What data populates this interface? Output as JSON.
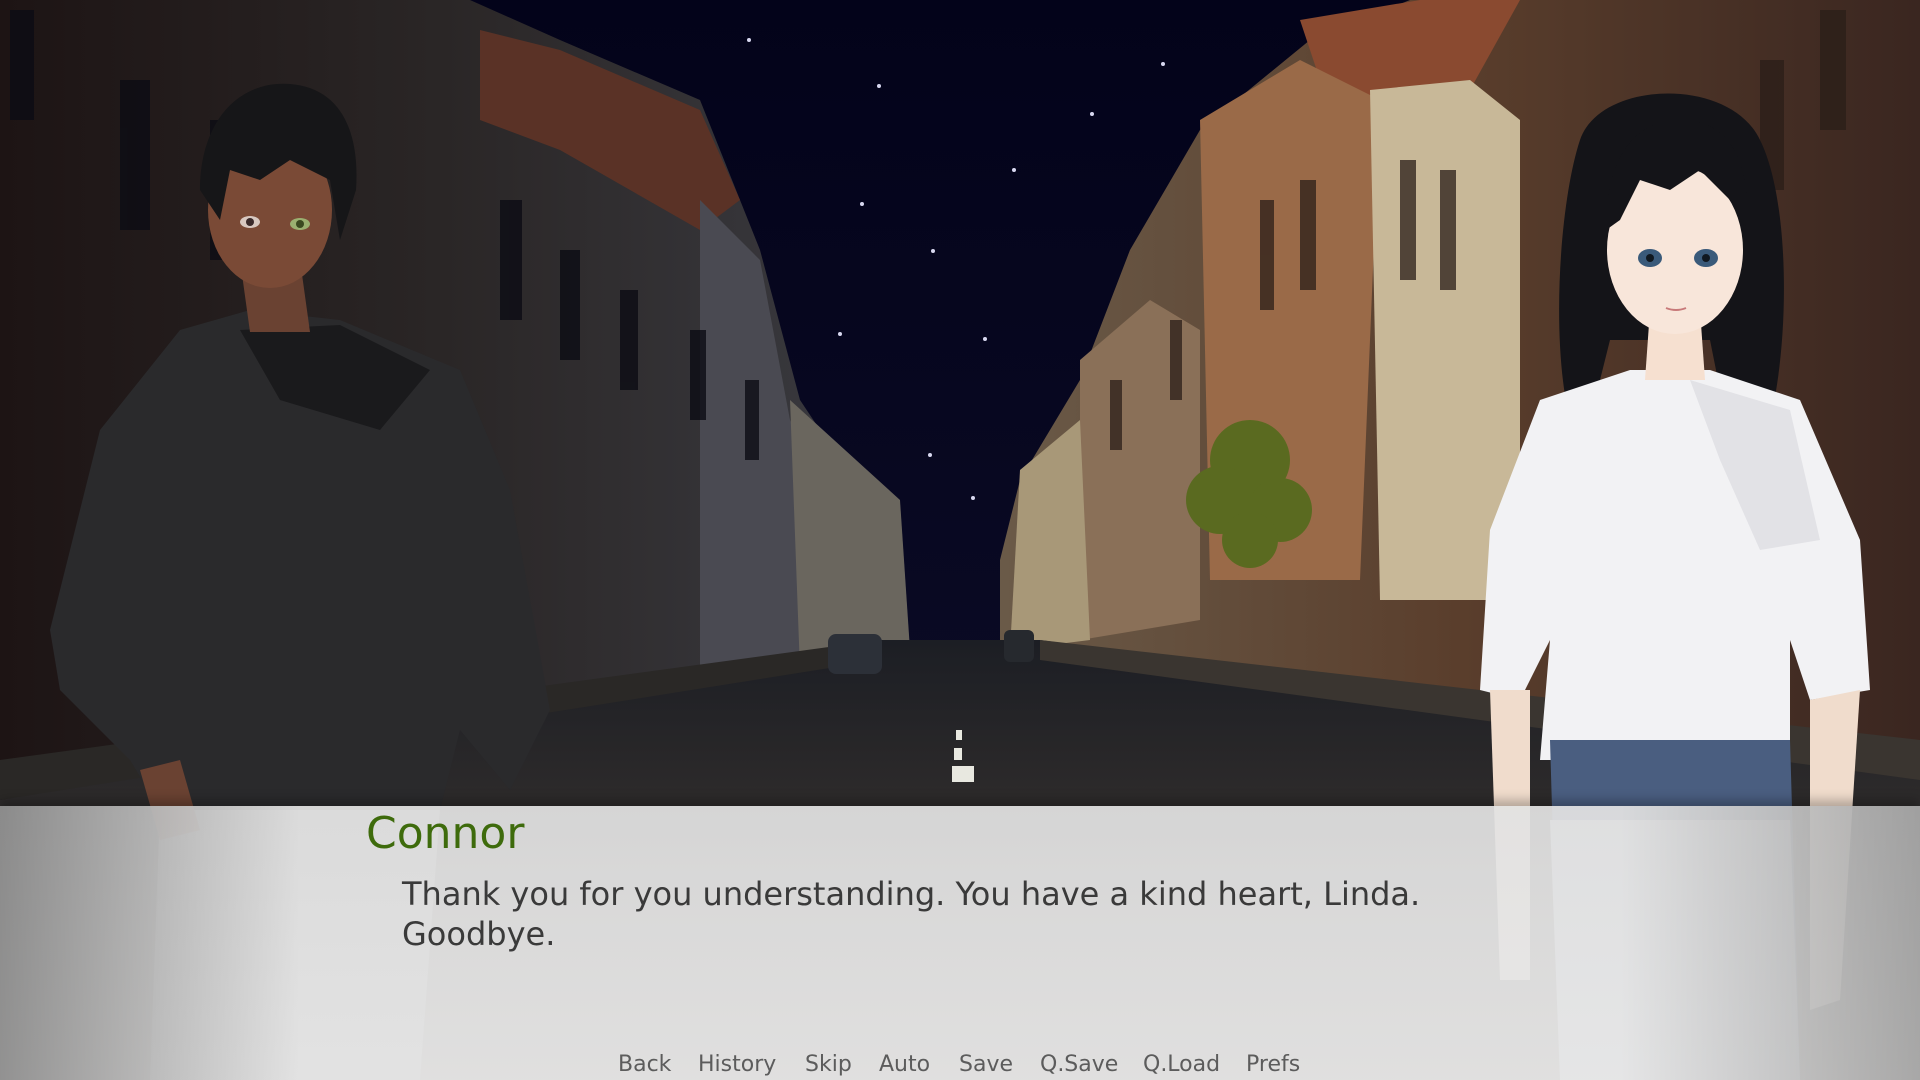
{
  "dialogue": {
    "speaker": "Connor",
    "speaker_color": "#3e6b0c",
    "text_line1": "Thank you for you understanding. You have a kind heart, Linda.",
    "text_line2": "Goodbye."
  },
  "quick_menu": {
    "back": "Back",
    "history": "History",
    "skip": "Skip",
    "auto": "Auto",
    "save": "Save",
    "qsave": "Q.Save",
    "qload": "Q.Load",
    "prefs": "Prefs"
  },
  "colors": {
    "sky": "#05051a",
    "dialogue_text": "#3a3a3a",
    "menu_text": "#5c5c5c"
  }
}
